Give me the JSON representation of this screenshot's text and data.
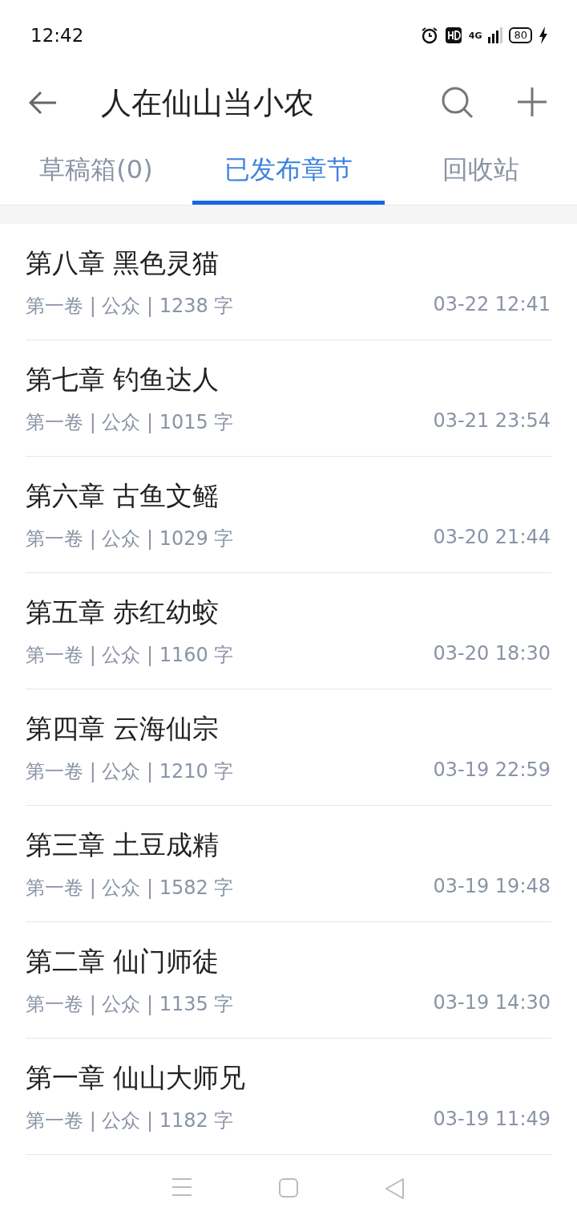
{
  "status_bar": {
    "time": "12:42",
    "network": "4G",
    "battery": "80"
  },
  "header": {
    "title": "人在仙山当小农"
  },
  "tabs": [
    {
      "label": "草稿箱(0)",
      "selected": false
    },
    {
      "label": "已发布章节",
      "selected": true
    },
    {
      "label": "回收站",
      "selected": false
    }
  ],
  "chapters": [
    {
      "title": "第八章 黑色灵猫",
      "meta": "第一卷 | 公众 | 1238 字",
      "time": "03-22 12:41"
    },
    {
      "title": "第七章 钓鱼达人",
      "meta": "第一卷 | 公众 | 1015 字",
      "time": "03-21 23:54"
    },
    {
      "title": "第六章 古鱼文鳐",
      "meta": "第一卷 | 公众 | 1029 字",
      "time": "03-20 21:44"
    },
    {
      "title": "第五章 赤红幼蛟",
      "meta": "第一卷 | 公众 | 1160 字",
      "time": "03-20 18:30"
    },
    {
      "title": "第四章 云海仙宗",
      "meta": "第一卷 | 公众 | 1210 字",
      "time": "03-19 22:59"
    },
    {
      "title": "第三章 土豆成精",
      "meta": "第一卷 | 公众 | 1582 字",
      "time": "03-19 19:48"
    },
    {
      "title": "第二章 仙门师徒",
      "meta": "第一卷 | 公众 | 1135 字",
      "time": "03-19 14:30"
    },
    {
      "title": "第一章 仙山大师兄",
      "meta": "第一卷 | 公众 | 1182 字",
      "time": "03-19 11:49"
    }
  ]
}
